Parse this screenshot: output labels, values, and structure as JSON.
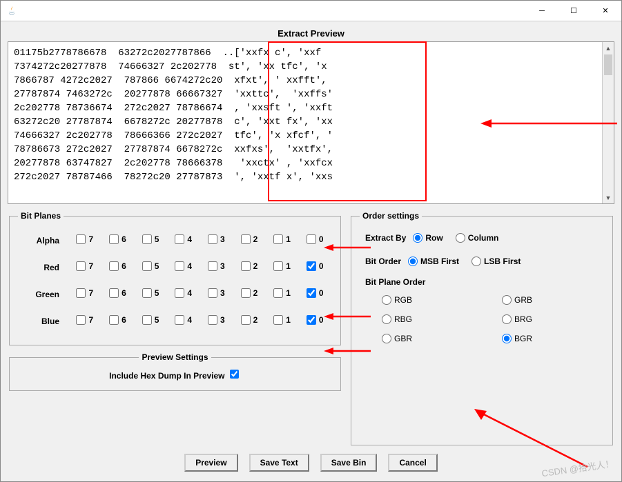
{
  "window": {
    "appIcon": "java"
  },
  "title": "Extract Preview",
  "preview_text": "01175b2778786678  63272c2027787866  ..['xxfx c', 'xxf\n7374272c20277878  74666327 2c202778  st', 'xx tfc', 'x\n7866787 4272c2027  787866 6674272c20  xfxt', ' xxfft',\n27787874 7463272c  20277878 66667327  'xxttc',  'xxffs'\n2c202778 78736674  272c2027 78786674  , 'xxsft ', 'xxft\n63272c20 27787874  6678272c 20277878  c', 'xxt fx', 'xx\n74666327 2c202778  78666366 272c2027  tfc', 'x xfcf', '\n78786673 272c2027  27787874 6678272c  xxfxs',  'xxtfx',\n20277878 63747827  2c202778 78666378   'xxctx' , 'xxfcx\n272c2027 78787466  78272c20 27787873  ', 'xxtf x', 'xxs",
  "planes_title": "Bit Planes",
  "channels": [
    "Alpha",
    "Red",
    "Green",
    "Blue"
  ],
  "bits": [
    "7",
    "6",
    "5",
    "4",
    "3",
    "2",
    "1",
    "0"
  ],
  "checked_map": {
    "Alpha": [],
    "Red": [
      0
    ],
    "Green": [
      0
    ],
    "Blue": [
      0
    ]
  },
  "preview_settings": {
    "title": "Preview Settings",
    "include_hex": "Include Hex Dump In Preview"
  },
  "order_settings": {
    "title": "Order settings",
    "extract_by_label": "Extract By",
    "extract_options": [
      "Row",
      "Column"
    ],
    "extract_selected": "Row",
    "bit_order_label": "Bit Order",
    "bit_order_options": [
      "MSB First",
      "LSB First"
    ],
    "bit_order_selected": "MSB First",
    "plane_order_label": "Bit Plane Order",
    "plane_order_options": [
      "RGB",
      "GRB",
      "RBG",
      "BRG",
      "GBR",
      "BGR"
    ],
    "plane_order_selected": "BGR"
  },
  "buttons": {
    "preview": "Preview",
    "save_text": "Save Text",
    "save_bin": "Save Bin",
    "cancel": "Cancel"
  },
  "watermark": "CSDN @拾光人！"
}
